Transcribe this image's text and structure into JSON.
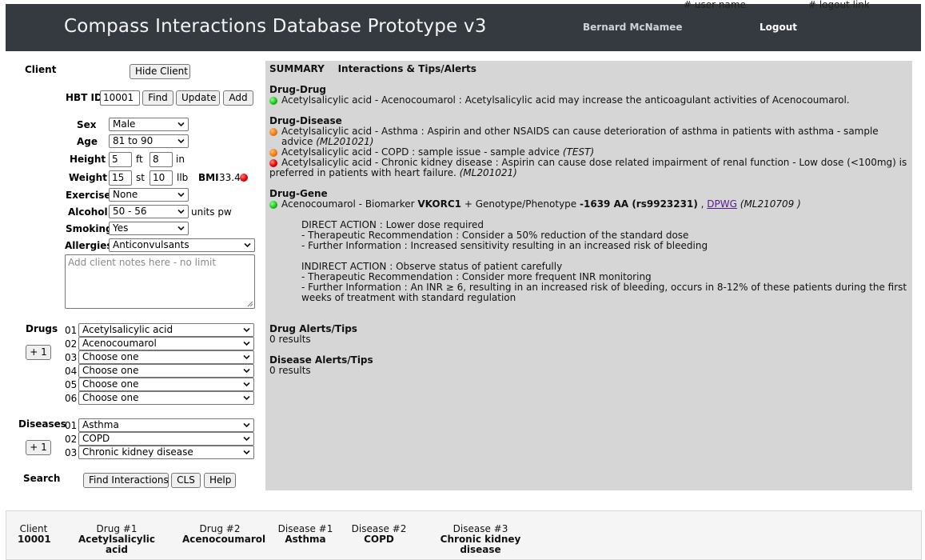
{
  "header": {
    "title": "Compass Interactions Database Prototype v3",
    "user_name": "Bernard McNamee",
    "logout_label": "Logout",
    "note_user": "# user name",
    "note_logout": "# logout link"
  },
  "client": {
    "section_label": "Client",
    "hide_button": "Hide Client",
    "hbt_label": "HBT ID",
    "hbt_value": "10001",
    "find_button": "Find",
    "update_button": "Update",
    "add_button": "Add",
    "sex_label": "Sex",
    "sex_value": "Male",
    "age_label": "Age",
    "age_value": "81 to 90",
    "height_label": "Height",
    "height_ft": "5",
    "ft_unit": "ft",
    "height_in": "8",
    "in_unit": "in",
    "weight_label": "Weight",
    "weight_st": "15",
    "st_unit": "st",
    "weight_lb": "10",
    "lb_unit": "llb",
    "bmi_label": "BMI",
    "bmi_value": "33.4",
    "exercise_label": "Exercise",
    "exercise_value": "None",
    "alcohol_label": "Alcohol",
    "alcohol_value": "50 - 56",
    "alcohol_unit": "units pw",
    "smoking_label": "Smoking",
    "smoking_value": "Yes",
    "allergies_label": "Allergies",
    "allergies_value": "Anticonvulsants",
    "notes_placeholder": "Add client notes here - no limit"
  },
  "drugs": {
    "label": "Drugs",
    "add_button": "+ 1",
    "items": [
      {
        "num": "01",
        "value": "Acetylsalicylic acid"
      },
      {
        "num": "02",
        "value": "Acenocoumarol"
      },
      {
        "num": "03",
        "value": "Choose one"
      },
      {
        "num": "04",
        "value": "Choose one"
      },
      {
        "num": "05",
        "value": "Choose one"
      },
      {
        "num": "06",
        "value": "Choose one"
      }
    ]
  },
  "diseases": {
    "label": "Diseases",
    "add_button": "+ 1",
    "items": [
      {
        "num": "01",
        "value": "Asthma"
      },
      {
        "num": "02",
        "value": "COPD"
      },
      {
        "num": "03",
        "value": "Chronic kidney disease"
      }
    ]
  },
  "search": {
    "label": "Search",
    "find_button": "Find Interactions",
    "cls_button": "CLS",
    "help_button": "Help"
  },
  "summary": {
    "heading_summary": "SUMMARY",
    "heading_interactions": "Interactions & Tips/Alerts",
    "drug_drug": {
      "title": "Drug-Drug",
      "lines": [
        {
          "status": "green",
          "text": "Acetylsalicylic acid - Acenocoumarol : Acetylsalicylic acid may increase the anticoagulant activities of Acenocoumarol."
        }
      ]
    },
    "drug_disease": {
      "title": "Drug-Disease",
      "lines": [
        {
          "status": "orange",
          "text": "Acetylsalicylic acid - Asthma : Aspirin and other NSAIDS can cause deterioration of asthma in patients with asthma - sample advice",
          "ref": "(ML201021)"
        },
        {
          "status": "orange",
          "text": "Acetylsalicylic acid - COPD : sample issue - sample advice",
          "ref": "(TEST)"
        },
        {
          "status": "red",
          "text": "Acetylsalicylic acid - Chronic kidney disease : Aspirin can cause dose related impairment of renal function - Low dose (<100mg) is preferred in patients with heart failure.",
          "ref": "(ML201021)"
        }
      ]
    },
    "drug_gene": {
      "title": "Drug-Gene",
      "status": "green",
      "pre": "Acenocoumarol - Biomarker",
      "biomarker": "VKORC1",
      "mid": "+ Genotype/Phenotype",
      "genotype": "-1639 AA (rs9923231)",
      "comma": ",",
      "link": "DPWG",
      "ref": "(ML210709 )",
      "direct_action": "DIRECT ACTION : Lower dose required",
      "direct_rec": "- Therapeutic Recommendation : Consider a 50% reduction of the standard dose",
      "direct_info": "- Further Information : Increased sensitivity resulting in an increased risk of bleeding",
      "indirect_action": "INDIRECT ACTION : Observe status of patient carefully",
      "indirect_rec": "- Therapeutic Recommendation : Consider more frequent INR monitoring",
      "indirect_info": "- Further Information : An INR ≥ 6, resulting in an increased risk of bleeding, occurs in 8-12% of these patients during the first weeks of treatment with standard regulation"
    },
    "drug_alerts": {
      "title": "Drug Alerts/Tips",
      "result": "0 results"
    },
    "disease_alerts": {
      "title": "Disease Alerts/Tips",
      "result": "0 results"
    }
  },
  "bottom_bar": {
    "columns": [
      {
        "title": "Client",
        "value": "10001"
      },
      {
        "title": "Drug #1",
        "value": "Acetylsalicylic acid"
      },
      {
        "title": "Drug #2",
        "value": "Acenocoumarol"
      },
      {
        "title": "Disease #1",
        "value": "Asthma"
      },
      {
        "title": "Disease #2",
        "value": "COPD"
      },
      {
        "title": "Disease #3",
        "value": "Chronic kidney disease"
      }
    ]
  }
}
